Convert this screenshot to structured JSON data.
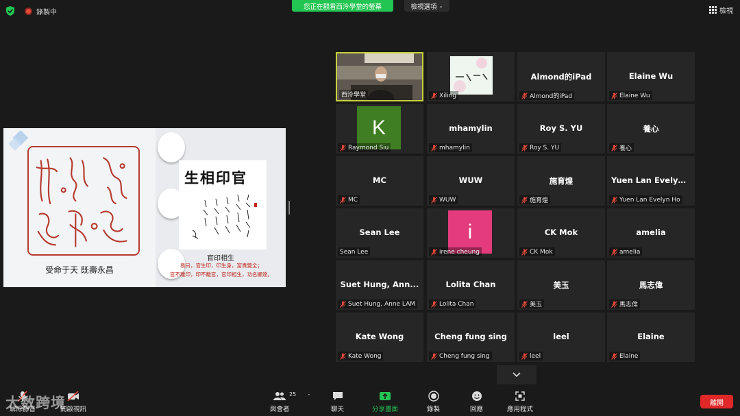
{
  "top_bar": {
    "recording_label": "錄製中",
    "viewing_banner": "您正在觀看西泠學堂的螢幕",
    "view_options_label": "檢視選項",
    "view_button_label": "檢視"
  },
  "slide": {
    "caption": "受命于天 既壽永昌",
    "calligraphy_title": "生相印官",
    "sub_title": "官印相生",
    "sub_text_1": "易曰，官生印，印生身，富貴雙全；",
    "sub_text_2": "官不離印，印不離官，官印相生，功名顯達。"
  },
  "gallery": {
    "participants": [
      {
        "name": "西泠學堂",
        "label": "西泠學堂",
        "type": "video",
        "active": true,
        "muted": false
      },
      {
        "name": "",
        "label": "Xiling",
        "type": "logo",
        "muted": true
      },
      {
        "name": "Almond的iPad",
        "label": "Almond的iPad",
        "type": "name",
        "muted": true
      },
      {
        "name": "Elaine Wu",
        "label": "Elaine Wu",
        "type": "name",
        "muted": true
      },
      {
        "name": "K",
        "label": "Raymond Siu",
        "type": "avatar",
        "avatar_color": "#3f7e22",
        "muted": true
      },
      {
        "name": "mhamylin",
        "label": "mhamylin",
        "type": "name",
        "muted": true
      },
      {
        "name": "Roy S. YU",
        "label": "Roy S. YU",
        "type": "name",
        "muted": true
      },
      {
        "name": "養心",
        "label": "養心",
        "type": "name",
        "muted": true
      },
      {
        "name": "MC",
        "label": "MC",
        "type": "name",
        "muted": true
      },
      {
        "name": "WUW",
        "label": "WUW",
        "type": "name",
        "muted": true
      },
      {
        "name": "施育煌",
        "label": "施育煌",
        "type": "name",
        "muted": true
      },
      {
        "name": "Yuen Lan Evelyn...",
        "label": "Yuen Lan Evelyn Ho",
        "type": "name",
        "muted": true
      },
      {
        "name": "Sean Lee",
        "label": "Sean Lee",
        "type": "name",
        "muted": false
      },
      {
        "name": "i",
        "label": "irene cheung",
        "type": "avatar",
        "avatar_color": "#e33b7c",
        "muted": true
      },
      {
        "name": "CK Mok",
        "label": "CK Mok",
        "type": "name",
        "muted": true
      },
      {
        "name": "amelia",
        "label": "amelia",
        "type": "name",
        "muted": true
      },
      {
        "name": "Suet Hung, Ann...",
        "label": "Suet Hung, Anne LAM",
        "type": "name",
        "muted": true
      },
      {
        "name": "Lolita Chan",
        "label": "Lolita Chan",
        "type": "name",
        "muted": true
      },
      {
        "name": "美玉",
        "label": "美玉",
        "type": "name",
        "muted": true
      },
      {
        "name": "馬志偉",
        "label": "馬志偉",
        "type": "name",
        "muted": true
      },
      {
        "name": "Kate Wong",
        "label": "Kate Wong",
        "type": "name",
        "muted": true
      },
      {
        "name": "Cheng fung sing",
        "label": "Cheng fung sing",
        "type": "name",
        "muted": true
      },
      {
        "name": "leel",
        "label": "leel",
        "type": "name",
        "muted": true
      },
      {
        "name": "Elaine",
        "label": "Elaine",
        "type": "name",
        "muted": true
      }
    ]
  },
  "toolbar": {
    "unmute_label": "解除靜音",
    "video_label": "開啟視訊",
    "participants_label": "與會者",
    "participants_count": "25",
    "chat_label": "聊天",
    "share_label": "分享畫面",
    "record_label": "錄製",
    "reactions_label": "回應",
    "apps_label": "應用程式",
    "end_label": "離開"
  },
  "watermark": "大数跨境",
  "colors": {
    "banner_green": "#23c552",
    "end_red": "#e02828",
    "active_border": "#c7d23a",
    "muted_red": "#e5493a"
  }
}
